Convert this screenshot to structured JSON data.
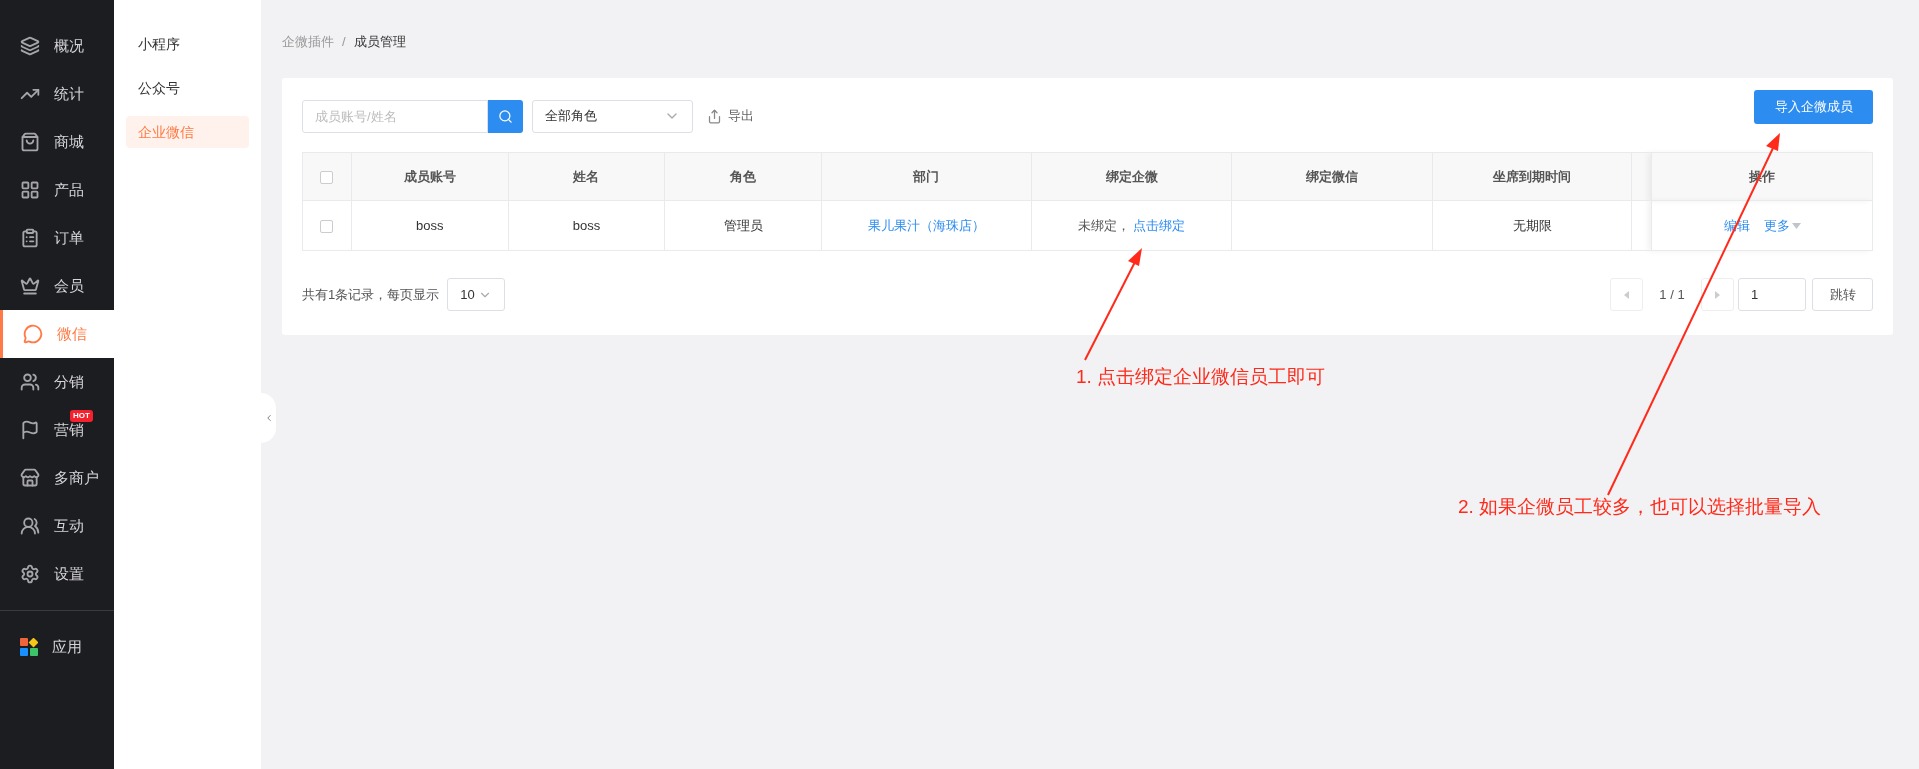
{
  "nav": [
    {
      "label": "概况",
      "selected": false
    },
    {
      "label": "统计",
      "selected": false
    },
    {
      "label": "商城",
      "selected": false
    },
    {
      "label": "产品",
      "selected": false
    },
    {
      "label": "订单",
      "selected": false
    },
    {
      "label": "会员",
      "selected": false
    },
    {
      "label": "微信",
      "selected": true
    },
    {
      "label": "分销",
      "selected": false
    },
    {
      "label": "营销",
      "selected": false,
      "badge": "HOT"
    },
    {
      "label": "多商户",
      "selected": false
    },
    {
      "label": "互动",
      "selected": false
    },
    {
      "label": "设置",
      "selected": false
    }
  ],
  "nav_bottom": [
    {
      "label": "应用",
      "selected": false
    }
  ],
  "subnav": [
    {
      "label": "小程序",
      "selected": false
    },
    {
      "label": "公众号",
      "selected": false
    },
    {
      "label": "企业微信",
      "selected": true
    }
  ],
  "breadcrumb": [
    "企微插件",
    "/",
    "成员管理"
  ],
  "toolbar": {
    "search_placeholder": "成员账号/姓名",
    "role_select": "全部角色",
    "export": "导出",
    "import_button": "导入企微成员"
  },
  "table": {
    "columns": [
      "成员账号",
      "姓名",
      "角色",
      "部门",
      "绑定企微",
      "绑定微信",
      "坐席到期时间",
      "操作"
    ],
    "rows": [
      {
        "checked": false,
        "account": "boss",
        "name": "boss",
        "role": "管理员",
        "department": "果儿果汁（海珠店）",
        "bind_status": "未绑定，",
        "bind_link": "点击绑定",
        "wechat": "",
        "expiry": "无期限",
        "actions": [
          "编辑",
          "更多"
        ]
      }
    ],
    "header_checked": false
  },
  "pagination": {
    "summary": "共有1条记录，每页显示",
    "page_size": "10",
    "pages": "1 / 1",
    "jump_value": "1",
    "jump_button": "跳转"
  },
  "annotations": [
    "1. 点击绑定企业微信员工即可",
    "2. 如果企微员工较多，也可以选择批量导入"
  ]
}
